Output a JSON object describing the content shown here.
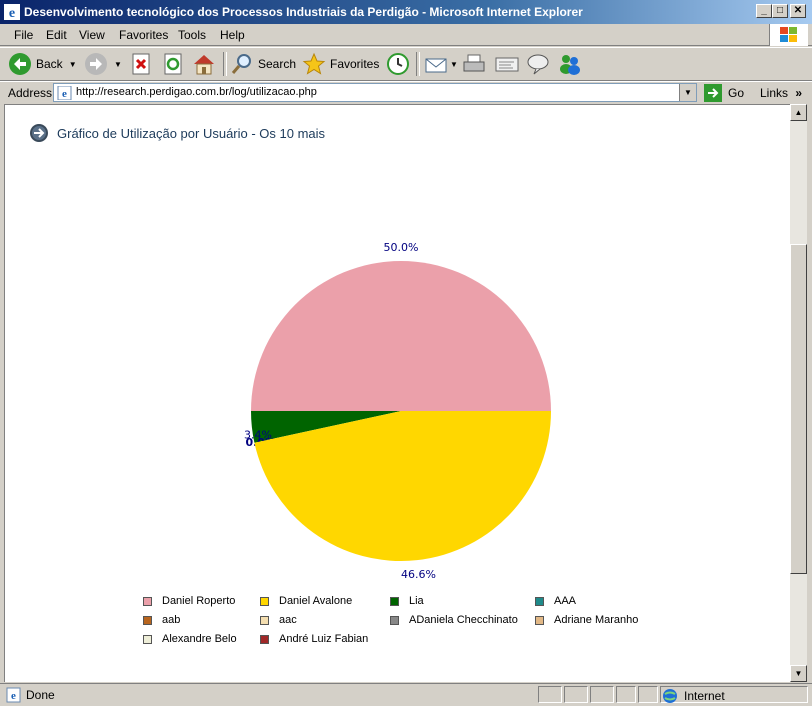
{
  "window": {
    "title": "Desenvolvimento tecnológico dos Processos Industriais da Perdigão - Microsoft Internet Explorer",
    "minimize_symbol": "_",
    "maximize_symbol": "□",
    "close_symbol": "✕"
  },
  "menu": {
    "file": "File",
    "edit": "Edit",
    "view": "View",
    "favorites": "Favorites",
    "tools": "Tools",
    "help": "Help"
  },
  "toolbar": {
    "back": "Back",
    "search": "Search",
    "favorites": "Favorites"
  },
  "address": {
    "label": "Address",
    "url": "http://research.perdigao.com.br/log/utilizacao.php",
    "go": "Go",
    "links": "Links"
  },
  "page": {
    "heading": "Gráfico de Utilização por Usuário - Os 10 mais"
  },
  "chart_data": {
    "type": "pie",
    "title": "Gráfico de Utilização por Usuário - Os 10 mais",
    "slices": [
      {
        "label": "Daniel Roperto",
        "value": 50.0,
        "value_label": "50.0%",
        "color": "#eba0aa"
      },
      {
        "label": "Lia",
        "value": 3.4,
        "value_label": "3.4%",
        "color": "#006400"
      },
      {
        "label": "AAA",
        "value": 0.0,
        "value_label": "0.0%",
        "color": "#1f8a8a"
      },
      {
        "label": "Daniel Avalone",
        "value": 46.6,
        "value_label": "46.6%",
        "color": "#ffd700"
      },
      {
        "label": "aab",
        "value": 0.0,
        "value_label": "",
        "color": "#b8651e"
      },
      {
        "label": "aac",
        "value": 0.0,
        "value_label": "",
        "color": "#f4deb0"
      },
      {
        "label": "ADaniela Checchinato",
        "value": 0.0,
        "value_label": "",
        "color": "#888888"
      },
      {
        "label": "Adriane Maranho",
        "value": 0.0,
        "value_label": "",
        "color": "#e2b886"
      },
      {
        "label": "Alexandre Belo",
        "value": 0.0,
        "value_label": "",
        "color": "#eeeed8"
      },
      {
        "label": "André Luiz Fabian",
        "value": 0.0,
        "value_label": "",
        "color": "#a02828"
      }
    ],
    "legend": [
      {
        "label": "Daniel Roperto",
        "color": "#eba0aa"
      },
      {
        "label": "Daniel Avalone",
        "color": "#ffd700"
      },
      {
        "label": "Lia",
        "color": "#006400"
      },
      {
        "label": "AAA",
        "color": "#1f8a8a"
      },
      {
        "label": "aab",
        "color": "#b8651e"
      },
      {
        "label": "aac",
        "color": "#f4deb0"
      },
      {
        "label": "ADaniela Checchinato",
        "color": "#888888"
      },
      {
        "label": "Adriane Maranho",
        "color": "#e2b886"
      },
      {
        "label": "Alexandre Belo",
        "color": "#eeeed8"
      },
      {
        "label": "André Luiz Fabian",
        "color": "#a02828"
      }
    ],
    "legend_placement": "bottom",
    "label_color": "#000080"
  },
  "status": {
    "text": "Done",
    "zone": "Internet"
  }
}
